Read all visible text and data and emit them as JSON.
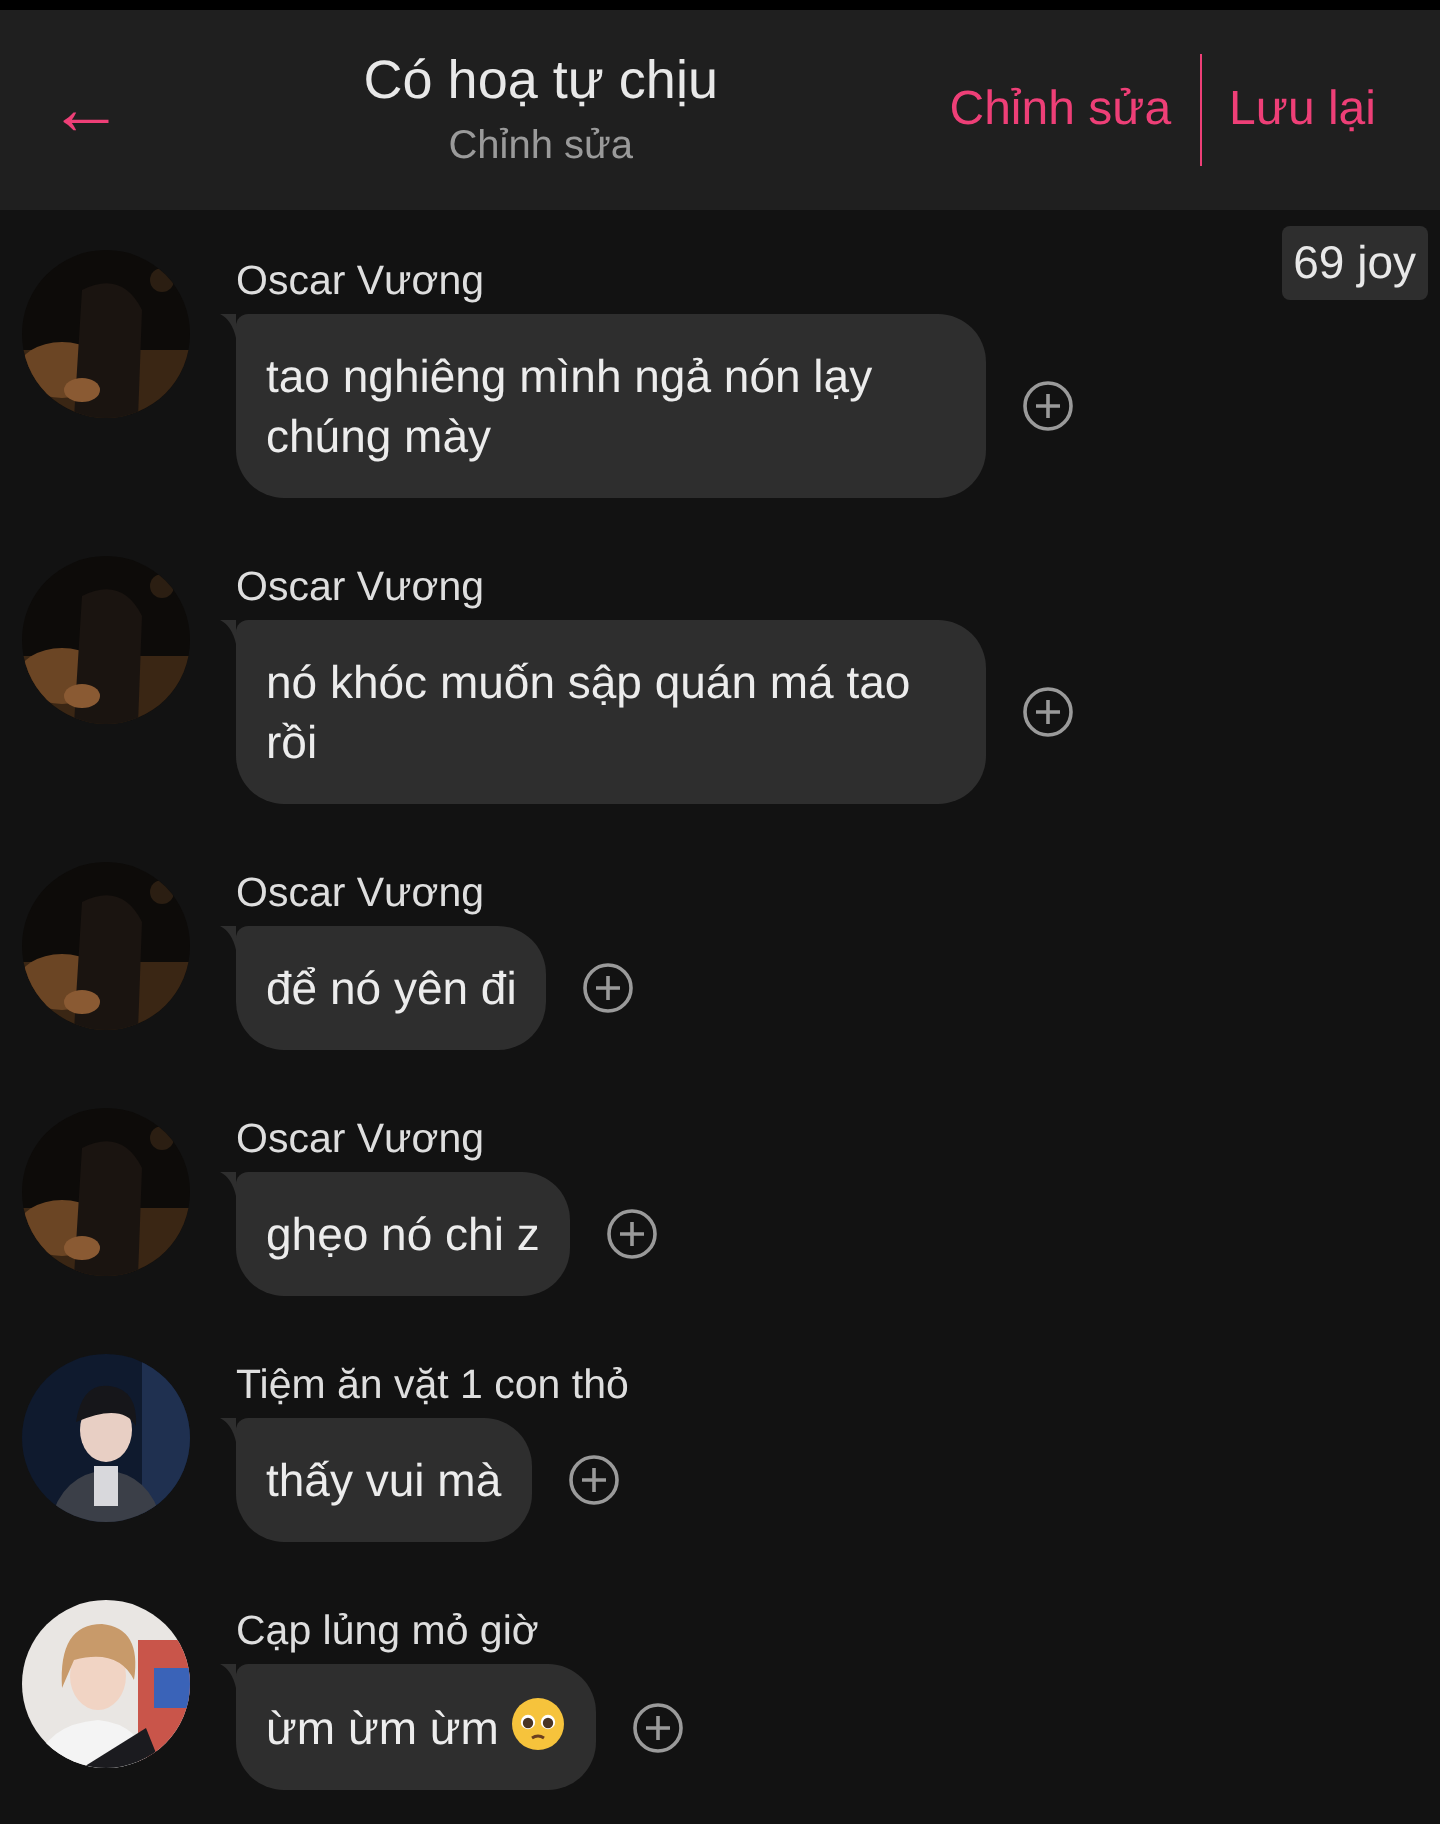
{
  "header": {
    "back": "←",
    "title": "Có hoạ tự chịu",
    "subtitle": "Chỉnh sửa",
    "actions": [
      "Chỉnh sửa",
      "Lưu lại"
    ]
  },
  "badge": "69 joy",
  "messages": [
    {
      "sender": "Oscar Vương",
      "text": "tao nghiêng mình ngả nón lạy chúng mày"
    },
    {
      "sender": "Oscar Vương",
      "text": "nó khóc muốn sập quán má tao rồi"
    },
    {
      "sender": "Oscar Vương",
      "text": "để nó yên đi"
    },
    {
      "sender": "Oscar Vương",
      "text": "ghẹo nó chi z"
    },
    {
      "sender": "Tiệm ăn vặt 1 con thỏ",
      "text": "thấy vui mà"
    },
    {
      "sender": "Cạp lủng mỏ giờ",
      "text": "ừm ừm ừm",
      "emoji": true
    }
  ]
}
